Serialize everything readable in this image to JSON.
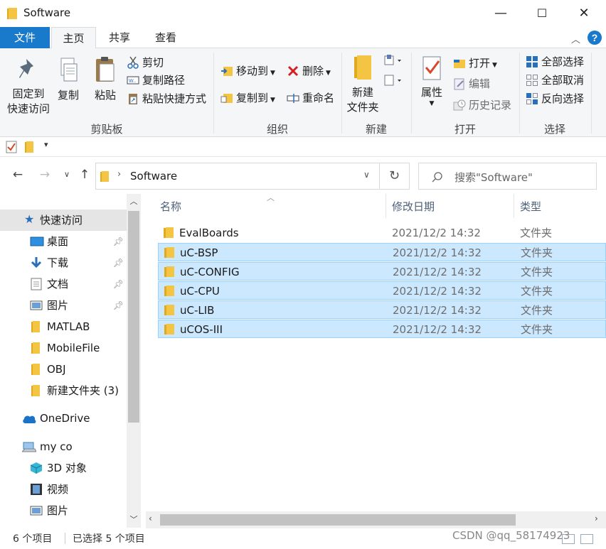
{
  "window": {
    "title": "Software",
    "minimize": "—",
    "maximize": "☐",
    "close": "✕"
  },
  "tabs": {
    "file": "文件",
    "home": "主页",
    "share": "共享",
    "view": "查看"
  },
  "ribbon": {
    "clipboard": {
      "pin": "固定到\n快速访问",
      "copy": "复制",
      "paste": "粘贴",
      "cut": "剪切",
      "copy_path": "复制路径",
      "paste_shortcut": "粘贴快捷方式",
      "label": "剪贴板"
    },
    "organize": {
      "move_to": "移动到",
      "copy_to": "复制到",
      "delete": "删除",
      "rename": "重命名",
      "label": "组织"
    },
    "new": {
      "new_folder": "新建\n文件夹",
      "label": "新建"
    },
    "open": {
      "properties": "属性",
      "open": "打开",
      "edit": "编辑",
      "history": "历史记录",
      "label": "打开"
    },
    "select": {
      "select_all": "全部选择",
      "select_none": "全部取消",
      "invert": "反向选择",
      "label": "选择"
    }
  },
  "address": {
    "path": "Software",
    "search_placeholder": "搜索\"Software\""
  },
  "nav": {
    "quick_access": "快速访问",
    "items": [
      {
        "label": "桌面",
        "icon": "desktop-icon",
        "pinned": true
      },
      {
        "label": "下载",
        "icon": "download-icon",
        "pinned": true
      },
      {
        "label": "文档",
        "icon": "document-icon",
        "pinned": true
      },
      {
        "label": "图片",
        "icon": "picture-icon",
        "pinned": true
      },
      {
        "label": "MATLAB",
        "icon": "folder-icon",
        "pinned": false
      },
      {
        "label": "MobileFile",
        "icon": "folder-icon",
        "pinned": false
      },
      {
        "label": "OBJ",
        "icon": "folder-icon",
        "pinned": false
      },
      {
        "label": "新建文件夹 (3)",
        "icon": "folder-icon",
        "pinned": false
      }
    ],
    "onedrive": "OneDrive",
    "this_pc": "my co",
    "pc_items": [
      {
        "label": "3D 对象",
        "icon": "3d-objects-icon"
      },
      {
        "label": "视频",
        "icon": "video-icon"
      },
      {
        "label": "图片",
        "icon": "picture-icon"
      }
    ]
  },
  "columns": {
    "name": "名称",
    "date": "修改日期",
    "type": "类型"
  },
  "files": [
    {
      "name": "EvalBoards",
      "date": "2021/12/2 14:32",
      "type": "文件夹",
      "selected": false
    },
    {
      "name": "uC-BSP",
      "date": "2021/12/2 14:32",
      "type": "文件夹",
      "selected": true
    },
    {
      "name": "uC-CONFIG",
      "date": "2021/12/2 14:32",
      "type": "文件夹",
      "selected": true
    },
    {
      "name": "uC-CPU",
      "date": "2021/12/2 14:32",
      "type": "文件夹",
      "selected": true
    },
    {
      "name": "uC-LIB",
      "date": "2021/12/2 14:32",
      "type": "文件夹",
      "selected": true
    },
    {
      "name": "uCOS-III",
      "date": "2021/12/2 14:32",
      "type": "文件夹",
      "selected": true
    }
  ],
  "status": {
    "count": "6 个项目",
    "selected": "已选择 5 个项目"
  },
  "watermark": "CSDN @qq_58174923",
  "colors": {
    "accent": "#1979ca",
    "selection": "#cce8ff",
    "folder": "#f4c443"
  }
}
